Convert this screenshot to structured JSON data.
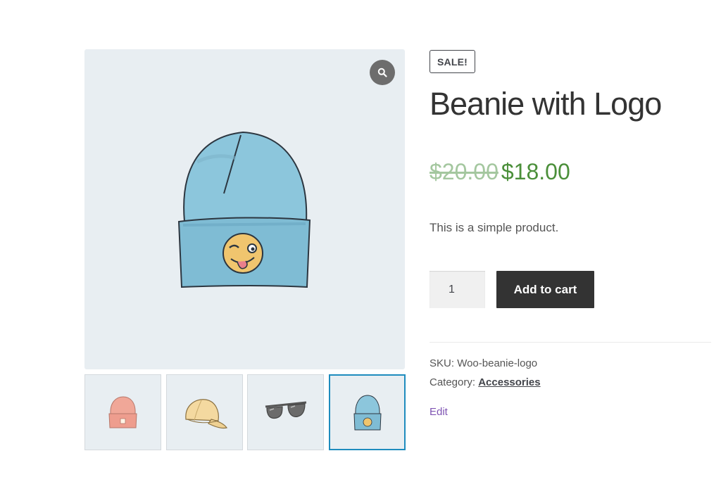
{
  "gallery": {
    "main_image": "beanie-with-logo",
    "zoom_icon": "search-icon",
    "thumbnails": [
      {
        "image": "beanie-pink"
      },
      {
        "image": "cap-yellow"
      },
      {
        "image": "sunglasses"
      },
      {
        "image": "beanie-with-logo",
        "active": true
      }
    ]
  },
  "product": {
    "badge": "SALE!",
    "title": "Beanie with Logo",
    "price_old": "$20.00",
    "price_new": "$18.00",
    "short_description": "This is a simple product.",
    "quantity": "1",
    "add_to_cart_label": "Add to cart",
    "sku_label": "SKU:",
    "sku_value": "Woo-beanie-logo",
    "category_label": "Category:",
    "category_value": "Accessories",
    "edit_label": "Edit"
  },
  "colors": {
    "accent_link": "#7f54b3",
    "price_sale": "#4b8f3a",
    "price_old": "#a4c79f",
    "active_thumb_border": "#1e8cbe",
    "button_bg": "#333333"
  }
}
